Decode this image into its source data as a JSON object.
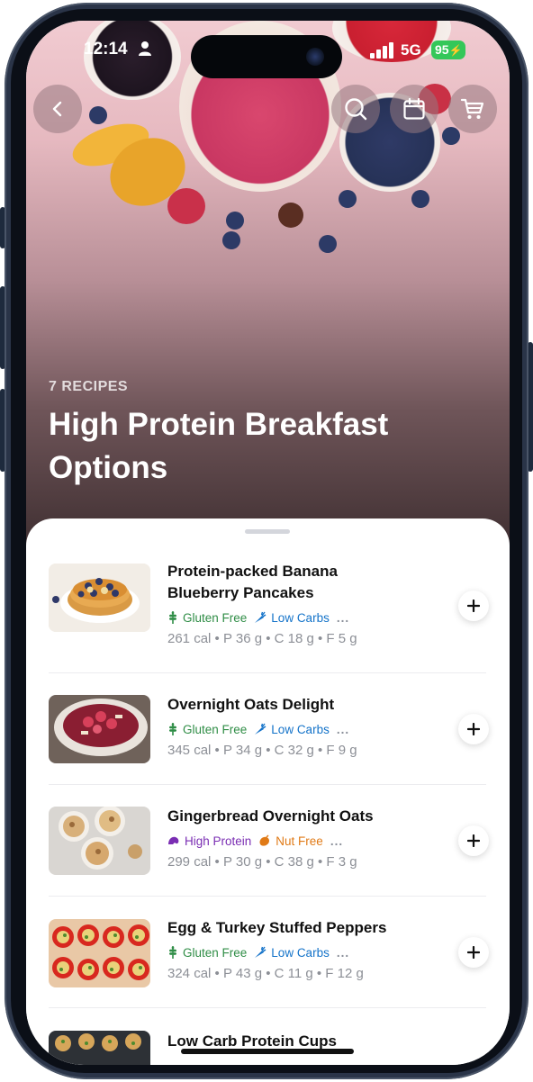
{
  "status_bar": {
    "time": "12:14",
    "network": "5G",
    "battery": "95"
  },
  "header": {
    "back_icon": "chevron-left-icon",
    "actions": [
      {
        "icon": "search-icon"
      },
      {
        "icon": "calendar-icon"
      },
      {
        "icon": "cart-icon"
      }
    ]
  },
  "hero": {
    "kicker": "7 RECIPES",
    "title": "High Protein Breakfast Options"
  },
  "recipes": [
    {
      "title": "Protein-packed Banana Blueberry Pancakes",
      "tags": [
        {
          "label": "Gluten Free",
          "icon": "wheat-icon",
          "color": "#2f8d46"
        },
        {
          "label": "Low Carbs",
          "icon": "carrot-icon",
          "color": "#1473c9"
        }
      ],
      "more": "...",
      "macros": "261 cal • P 36 g • C 18 g • F 5 g"
    },
    {
      "title": "Overnight Oats Delight",
      "tags": [
        {
          "label": "Gluten Free",
          "icon": "wheat-icon",
          "color": "#2f8d46"
        },
        {
          "label": "Low Carbs",
          "icon": "carrot-icon",
          "color": "#1473c9"
        }
      ],
      "more": "...",
      "macros": "345 cal • P 34 g • C 32 g • F 9 g"
    },
    {
      "title": "Gingerbread Overnight Oats",
      "tags": [
        {
          "label": "High Protein",
          "icon": "muscle-icon",
          "color": "#7a2db3"
        },
        {
          "label": "Nut Free",
          "icon": "nut-icon",
          "color": "#e07a16"
        }
      ],
      "more": "...",
      "macros": "299 cal • P 30 g • C 38 g • F 3 g"
    },
    {
      "title": "Egg & Turkey Stuffed Peppers",
      "tags": [
        {
          "label": "Gluten Free",
          "icon": "wheat-icon",
          "color": "#2f8d46"
        },
        {
          "label": "Low Carbs",
          "icon": "carrot-icon",
          "color": "#1473c9"
        }
      ],
      "more": "...",
      "macros": "324 cal • P 43 g • C 11 g • F 12 g"
    },
    {
      "title": "Low Carb Protein Cups"
    }
  ],
  "colors": {
    "accent_green": "#2f8d46",
    "accent_blue": "#1473c9",
    "accent_purple": "#7a2db3",
    "accent_orange": "#e07a16",
    "battery_green": "#34c759"
  }
}
